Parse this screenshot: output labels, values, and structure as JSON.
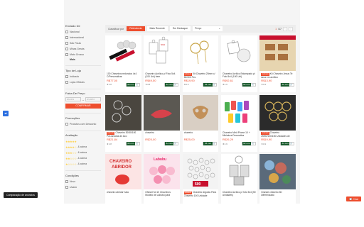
{
  "sidebar": {
    "shipping": {
      "title": "Enviado De",
      "options": [
        "Nacional",
        "Internacional",
        "São Paulo",
        "Minas Gerais",
        "Mato Grosso"
      ],
      "more": "Mais"
    },
    "shop": {
      "title": "Tipo de Loja",
      "options": [
        "Indicado",
        "Lojas Oficiais"
      ]
    },
    "price": {
      "title": "Faixa De Preço",
      "min_placeholder": "R$ MIN",
      "max_placeholder": "R$ MÁX",
      "apply": "CONFIRMAR"
    },
    "promo": {
      "title": "Promoções",
      "options": [
        "Produtos com Desconto"
      ]
    },
    "rating": {
      "title": "Avaliação",
      "suffix": "& acima"
    },
    "condition": {
      "title": "Condições",
      "options": [
        "Novo",
        "Usado"
      ]
    }
  },
  "sortbar": {
    "label": "Classificar por",
    "buttons": [
      "Relevância",
      "Mais Recente",
      "Em Destaque"
    ],
    "price_select": "Preço",
    "page_current": "1",
    "page_total": "/17"
  },
  "products": [
    {
      "title": "100 Chaveiros redondos 4x4 C/Personalizar",
      "badge": "",
      "price": "R$77,00",
      "rating": "★4.8",
      "sold": "62 mm",
      "avail": ""
    },
    {
      "title": "Chaveiro Acrílico p/ Foto 5x4 (100 Uni) bem",
      "badge": "",
      "price": "R$49,50",
      "rating": "★4.8",
      "sold": "62 mm",
      "avail": ""
    },
    {
      "title": "Kit Chaveiro 25mm c/ 50/300 Pcs",
      "badge": "Indicado",
      "price": "R$19,90",
      "rating": "★4.9",
      "sold": "64 mm",
      "avail": ""
    },
    {
      "title": "Chaveiro Acrílico Estampado p/ Foto 5x4 (100 Uni)",
      "badge": "",
      "price": "R$92,61",
      "rating": "★4.9",
      "sold": "62 mm",
      "avail": ""
    },
    {
      "title": "Kit Chaveiro Jesus Te Ama em acrílico",
      "badge": "Indicado",
      "price": "R$13,90",
      "rating": "★4.9",
      "sold": "62 mm",
      "avail": ""
    },
    {
      "title": "Chaveiro 30/50/100 Pcs Argolas de Aço",
      "badge": "Indicado",
      "price": "R$21,84",
      "rating": "★4.8",
      "sold": "62 mm",
      "avail": ""
    },
    {
      "title": "chaveiro",
      "badge": "",
      "price": "R$25,00",
      "rating": "",
      "sold": "64 mm",
      "avail": ""
    },
    {
      "title": "chaveiro",
      "badge": "",
      "price": "R$25,00",
      "rating": "",
      "sold": "64 mm",
      "avail": ""
    },
    {
      "title": "Chaveiro Mini iPhone 10 + Miniatura Decorativa",
      "badge": "",
      "price": "R$26,29",
      "rating": "★4.9",
      "sold": "62 mm",
      "avail": ""
    },
    {
      "title": "Chaveiro 25/50/100/150 Unidades de Metal",
      "badge": "Indicado",
      "price": "R$19,90",
      "rating": "★4.9",
      "sold": "64 mm",
      "avail": ""
    },
    {
      "title": "chaveiro abridor hala",
      "badge": "",
      "price": "",
      "rating": "",
      "sold": "",
      "avail": ""
    },
    {
      "title": "Oficial Hot 10 Chaveiros Modelo de Labubu para",
      "badge": "",
      "price": "",
      "rating": "",
      "sold": "",
      "avail": ""
    },
    {
      "title": "Chaveiro Argolas Para Chaveiro 100 Unidade",
      "badge": "Indicado",
      "price": "",
      "rating": "",
      "sold": "",
      "avail": ""
    },
    {
      "title": "Chaveiro Acrílico p/ foto 5x4 (50 Unidades)",
      "badge": "",
      "price": "",
      "rating": "",
      "sold": "",
      "avail": ""
    },
    {
      "title": "Grande chaveiro 3D Diferenciado",
      "badge": "",
      "price": "",
      "rating": "",
      "sold": "",
      "avail": ""
    }
  ],
  "toast": "Comparação de anúncios",
  "chat": "Chat",
  "float_icon": "translate-icon"
}
